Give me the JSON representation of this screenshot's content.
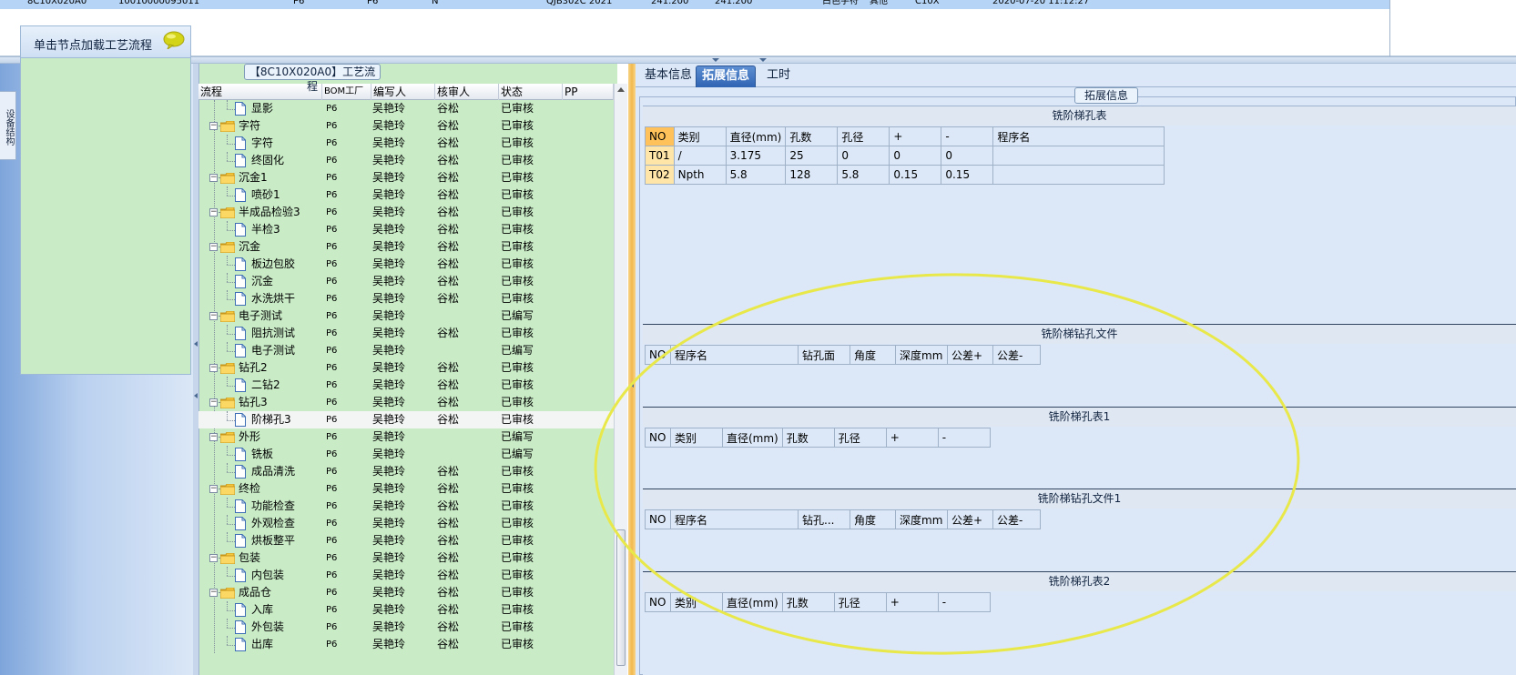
{
  "top_grid": {
    "row_cells": [
      "8C10X020A0",
      "10010000095011",
      "P6",
      "P6",
      "N",
      "QJB302C 2021",
      "241.200",
      "241.200",
      "白色字符",
      "其他",
      "C10X",
      "2020-07-20 11:12:27"
    ]
  },
  "left_panel": {
    "vertical_tab_label": "设备结构",
    "title": "单击节点加载工艺流程",
    "comment_icon": "speech-bubble-icon"
  },
  "tree_panel": {
    "caption": "【8C10X020A0】工艺流程",
    "columns": [
      "流程",
      "BOM工厂",
      "编写人",
      "核审人",
      "状态",
      "PP"
    ],
    "rows": [
      {
        "level": 2,
        "type": "file",
        "name": "显影",
        "bom": "P6",
        "writer": "吴艳玲",
        "reviewer": "谷松",
        "status": "已审核"
      },
      {
        "level": 1,
        "type": "folder",
        "name": "字符",
        "bom": "P6",
        "writer": "吴艳玲",
        "reviewer": "谷松",
        "status": "已审核"
      },
      {
        "level": 2,
        "type": "file",
        "name": "字符",
        "bom": "P6",
        "writer": "吴艳玲",
        "reviewer": "谷松",
        "status": "已审核"
      },
      {
        "level": 2,
        "type": "file",
        "name": "终固化",
        "bom": "P6",
        "writer": "吴艳玲",
        "reviewer": "谷松",
        "status": "已审核"
      },
      {
        "level": 1,
        "type": "folder",
        "name": "沉金1",
        "bom": "P6",
        "writer": "吴艳玲",
        "reviewer": "谷松",
        "status": "已审核"
      },
      {
        "level": 2,
        "type": "file",
        "name": "喷砂1",
        "bom": "P6",
        "writer": "吴艳玲",
        "reviewer": "谷松",
        "status": "已审核"
      },
      {
        "level": 1,
        "type": "folder",
        "name": "半成品检验3",
        "bom": "P6",
        "writer": "吴艳玲",
        "reviewer": "谷松",
        "status": "已审核"
      },
      {
        "level": 2,
        "type": "file",
        "name": "半检3",
        "bom": "P6",
        "writer": "吴艳玲",
        "reviewer": "谷松",
        "status": "已审核"
      },
      {
        "level": 1,
        "type": "folder",
        "name": "沉金",
        "bom": "P6",
        "writer": "吴艳玲",
        "reviewer": "谷松",
        "status": "已审核"
      },
      {
        "level": 2,
        "type": "file",
        "name": "板边包胶",
        "bom": "P6",
        "writer": "吴艳玲",
        "reviewer": "谷松",
        "status": "已审核"
      },
      {
        "level": 2,
        "type": "file",
        "name": "沉金",
        "bom": "P6",
        "writer": "吴艳玲",
        "reviewer": "谷松",
        "status": "已审核"
      },
      {
        "level": 2,
        "type": "file",
        "name": "水洗烘干",
        "bom": "P6",
        "writer": "吴艳玲",
        "reviewer": "谷松",
        "status": "已审核"
      },
      {
        "level": 1,
        "type": "folder",
        "name": "电子测试",
        "bom": "P6",
        "writer": "吴艳玲",
        "reviewer": "",
        "status": "已编写"
      },
      {
        "level": 2,
        "type": "file",
        "name": "阻抗测试",
        "bom": "P6",
        "writer": "吴艳玲",
        "reviewer": "谷松",
        "status": "已审核"
      },
      {
        "level": 2,
        "type": "file",
        "name": "电子测试",
        "bom": "P6",
        "writer": "吴艳玲",
        "reviewer": "",
        "status": "已编写"
      },
      {
        "level": 1,
        "type": "folder",
        "name": "钻孔2",
        "bom": "P6",
        "writer": "吴艳玲",
        "reviewer": "谷松",
        "status": "已审核"
      },
      {
        "level": 2,
        "type": "file",
        "name": "二钻2",
        "bom": "P6",
        "writer": "吴艳玲",
        "reviewer": "谷松",
        "status": "已审核"
      },
      {
        "level": 1,
        "type": "folder",
        "name": "钻孔3",
        "bom": "P6",
        "writer": "吴艳玲",
        "reviewer": "谷松",
        "status": "已审核"
      },
      {
        "level": 2,
        "type": "file",
        "name": "阶梯孔3",
        "bom": "P6",
        "writer": "吴艳玲",
        "reviewer": "谷松",
        "status": "已审核",
        "selected": true
      },
      {
        "level": 1,
        "type": "folder",
        "name": "外形",
        "bom": "P6",
        "writer": "吴艳玲",
        "reviewer": "",
        "status": "已编写"
      },
      {
        "level": 2,
        "type": "file",
        "name": "铣板",
        "bom": "P6",
        "writer": "吴艳玲",
        "reviewer": "",
        "status": "已编写"
      },
      {
        "level": 2,
        "type": "file",
        "name": "成品清洗",
        "bom": "P6",
        "writer": "吴艳玲",
        "reviewer": "谷松",
        "status": "已审核"
      },
      {
        "level": 1,
        "type": "folder",
        "name": "终检",
        "bom": "P6",
        "writer": "吴艳玲",
        "reviewer": "谷松",
        "status": "已审核"
      },
      {
        "level": 2,
        "type": "file",
        "name": "功能检查",
        "bom": "P6",
        "writer": "吴艳玲",
        "reviewer": "谷松",
        "status": "已审核"
      },
      {
        "level": 2,
        "type": "file",
        "name": "外观检查",
        "bom": "P6",
        "writer": "吴艳玲",
        "reviewer": "谷松",
        "status": "已审核"
      },
      {
        "level": 2,
        "type": "file",
        "name": "烘板整平",
        "bom": "P6",
        "writer": "吴艳玲",
        "reviewer": "谷松",
        "status": "已审核"
      },
      {
        "level": 1,
        "type": "folder",
        "name": "包装",
        "bom": "P6",
        "writer": "吴艳玲",
        "reviewer": "谷松",
        "status": "已审核"
      },
      {
        "level": 2,
        "type": "file",
        "name": "内包装",
        "bom": "P6",
        "writer": "吴艳玲",
        "reviewer": "谷松",
        "status": "已审核"
      },
      {
        "level": 1,
        "type": "folder",
        "name": "成品仓",
        "bom": "P6",
        "writer": "吴艳玲",
        "reviewer": "谷松",
        "status": "已审核"
      },
      {
        "level": 2,
        "type": "file",
        "name": "入库",
        "bom": "P6",
        "writer": "吴艳玲",
        "reviewer": "谷松",
        "status": "已审核"
      },
      {
        "level": 2,
        "type": "file",
        "name": "外包装",
        "bom": "P6",
        "writer": "吴艳玲",
        "reviewer": "谷松",
        "status": "已审核"
      },
      {
        "level": 2,
        "type": "file",
        "name": "出库",
        "bom": "P6",
        "writer": "吴艳玲",
        "reviewer": "谷松",
        "status": "已审核"
      }
    ]
  },
  "right_panel": {
    "tabs": [
      {
        "label": "基本信息",
        "active": false
      },
      {
        "label": "拓展信息",
        "active": true
      },
      {
        "label": "工时",
        "active": false
      }
    ],
    "group_caption": "拓展信息",
    "sections": [
      {
        "title": "铣阶梯孔表",
        "headers": [
          "NO",
          "类别",
          "直径(mm)",
          "孔数",
          "孔径",
          "+",
          "-",
          "程序名"
        ],
        "rows": [
          [
            "T01",
            "/",
            "3.175",
            "25",
            "0",
            "0",
            "0",
            ""
          ],
          [
            "T02",
            "Npth",
            "5.8",
            "128",
            "5.8",
            "0.15",
            "0.15",
            ""
          ]
        ]
      },
      {
        "title": "铣阶梯钻孔文件",
        "headers": [
          "NO",
          "程序名",
          "钻孔面",
          "角度",
          "深度mm",
          "公差+",
          "公差-"
        ],
        "rows": []
      },
      {
        "title": "铣阶梯孔表1",
        "headers": [
          "NO",
          "类别",
          "直径(mm)",
          "孔数",
          "孔径",
          "+",
          "-"
        ],
        "rows": []
      },
      {
        "title": "铣阶梯钻孔文件1",
        "headers": [
          "NO",
          "程序名",
          "钻孔...",
          "角度",
          "深度mm",
          "公差+",
          "公差-"
        ],
        "rows": []
      },
      {
        "title": "铣阶梯孔表2",
        "headers": [
          "NO",
          "类别",
          "直径(mm)",
          "孔数",
          "孔径",
          "+",
          "-"
        ],
        "rows": []
      }
    ]
  },
  "colors": {
    "tree_bg": "#c9ecc7",
    "panel_bg": "#dce8f7",
    "active_tab": "#2f64b3",
    "annotation": "#e8e84a",
    "selected_header": "#ffc25a"
  }
}
